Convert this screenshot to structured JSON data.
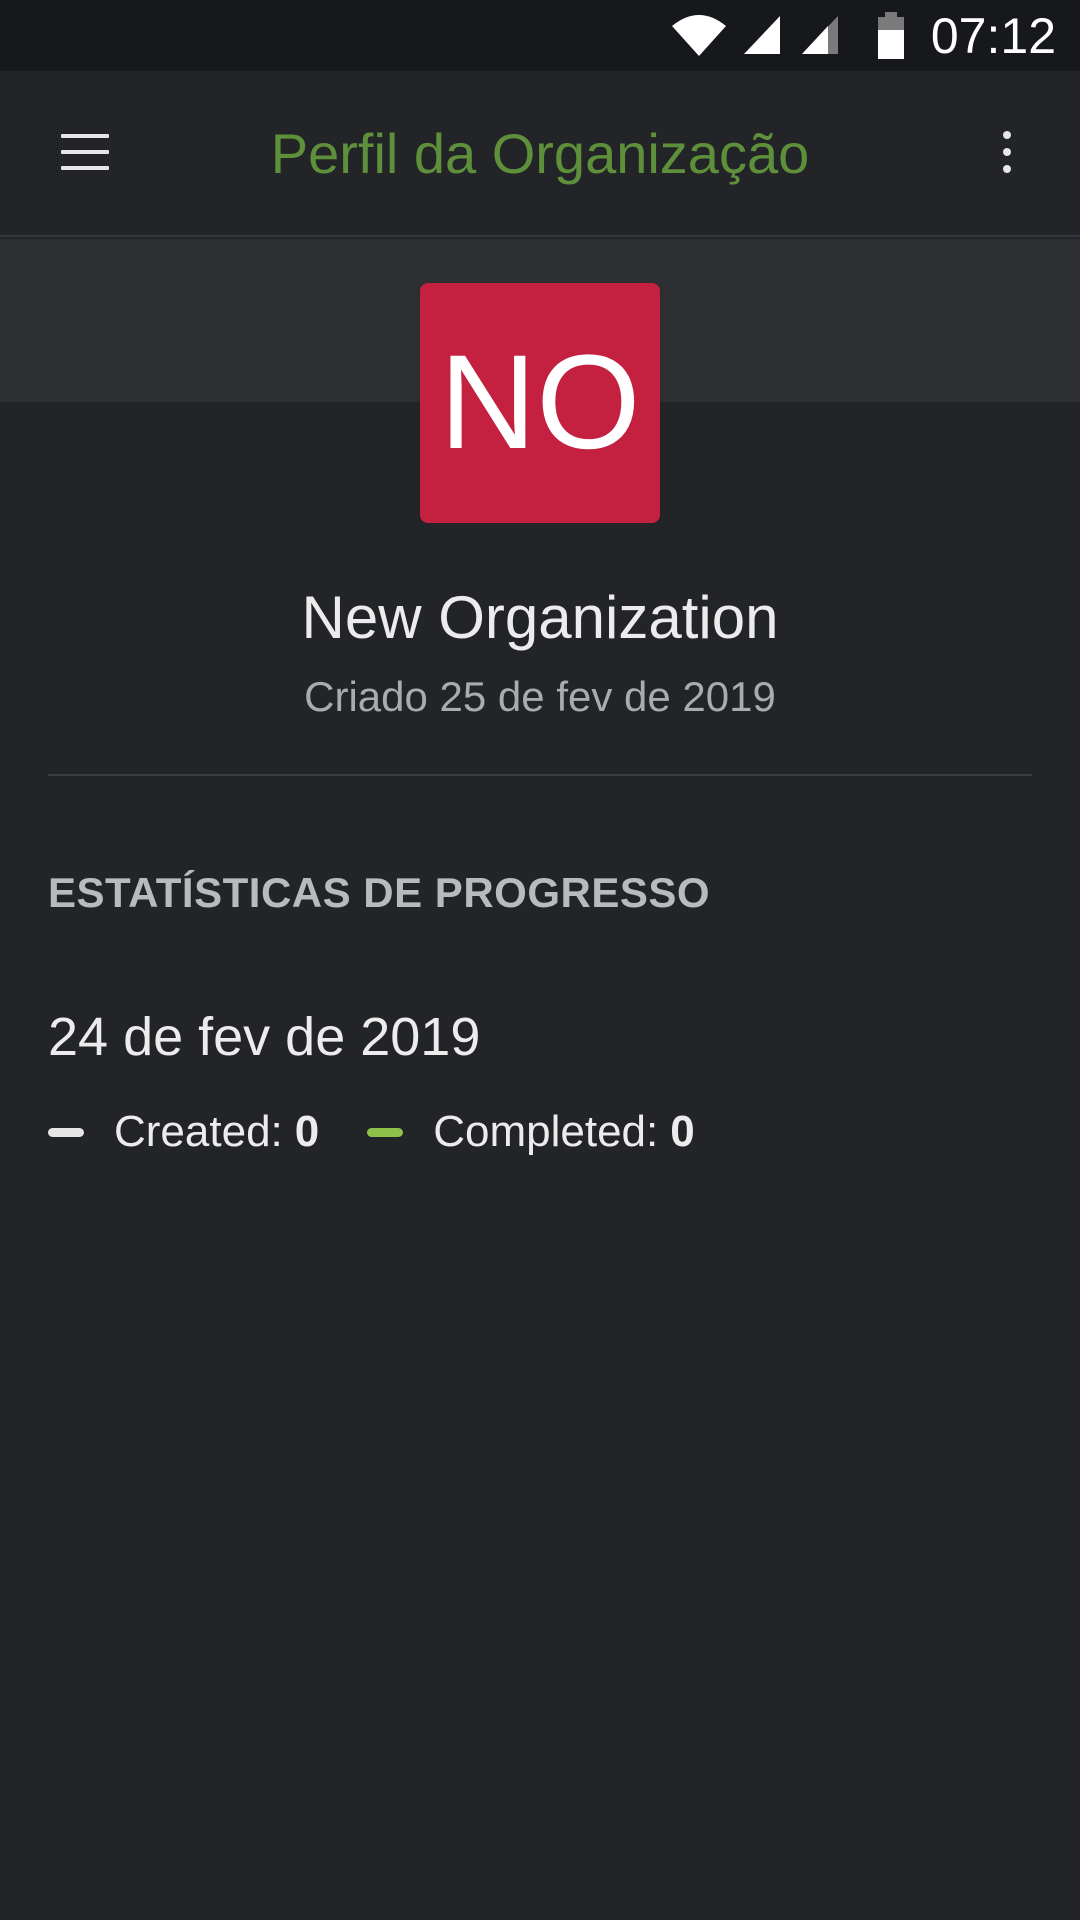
{
  "status_bar": {
    "time": "07:12",
    "icons": [
      "wifi-icon",
      "signal-icon",
      "signal-icon",
      "battery-icon"
    ]
  },
  "app_bar": {
    "title": "Perfil da Organização",
    "title_color": "#5e8f3a",
    "menu_icon": "hamburger-menu-icon",
    "overflow_icon": "more-vert-icon"
  },
  "organization": {
    "avatar_initials": "NO",
    "avatar_color": "#c42141",
    "name": "New Organization",
    "created": "Criado 25 de fev de 2019"
  },
  "stats": {
    "section_title": "ESTATÍSTICAS DE PROGRESSO",
    "date": "24 de fev de 2019",
    "legend": [
      {
        "label": "Created:",
        "value": "0",
        "color": "#e6e6e6"
      },
      {
        "label": "Completed:",
        "value": "0",
        "color": "#8dc149"
      }
    ]
  }
}
